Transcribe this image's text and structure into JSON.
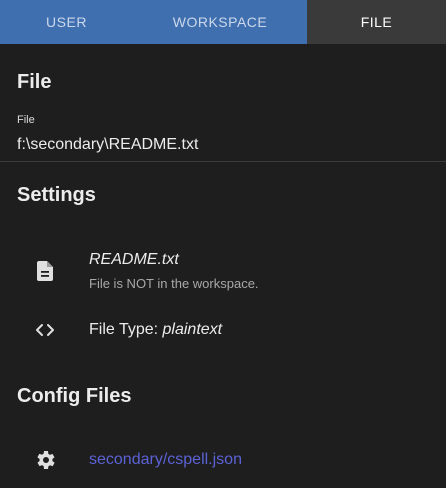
{
  "tabs": [
    {
      "label": "User"
    },
    {
      "label": "Workspace"
    },
    {
      "label": "File"
    }
  ],
  "file_section": {
    "heading": "File",
    "field_label": "File",
    "field_value": "f:\\secondary\\README.txt"
  },
  "settings": {
    "heading": "Settings",
    "file_name": "README.txt",
    "file_status": "File is NOT in the workspace.",
    "file_type_label": "File Type: ",
    "file_type_value": "plaintext",
    "icons": [
      "file-document-icon",
      "code-brackets-icon"
    ]
  },
  "config_files": {
    "heading": "Config Files",
    "items": [
      {
        "label": "secondary/cspell.json",
        "icon": "gear-icon"
      }
    ],
    "link_color": "#5b62d6"
  },
  "colors": {
    "tab_active_bg": "#3f6fae",
    "tab_selected_bg": "#3a3a3a",
    "background": "#1e1e1e"
  }
}
